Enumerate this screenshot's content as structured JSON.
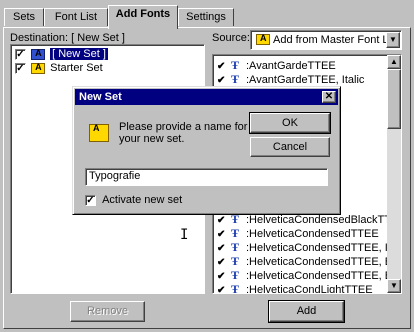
{
  "tabs": [
    {
      "label": "Sets",
      "active": false
    },
    {
      "label": "Font List",
      "active": false
    },
    {
      "label": "Add Fonts",
      "active": true
    },
    {
      "label": "Settings",
      "active": false
    }
  ],
  "destination": {
    "label": "Destination: [ New Set ]",
    "items": [
      {
        "label": "[ New Set ]",
        "checked": true,
        "selected": true,
        "icon": "blue-font-set-icon"
      },
      {
        "label": "Starter Set",
        "checked": true,
        "selected": false,
        "icon": "yellow-font-set-icon"
      }
    ]
  },
  "source": {
    "label": "Source:",
    "dropdown_value": "Add from Master Font List",
    "fonts": [
      {
        "name": "AvantGardeTTEE",
        "visible": "AvantGardeTTEE"
      },
      {
        "name": "AvantGardeTTEE, Italic",
        "visible": "AvantGardeTTEE, Italic"
      },
      {
        "name": "",
        "visible": ""
      },
      {
        "name": "d Italic",
        "visible": "d Italic"
      },
      {
        "name": "",
        "visible": ""
      },
      {
        "name": "",
        "visible": ""
      },
      {
        "name": "",
        "visible": ""
      },
      {
        "name": "",
        "visible": ""
      },
      {
        "name": "",
        "visible": ""
      },
      {
        "name": "talic",
        "visible": "talic"
      },
      {
        "name": "TEE",
        "visible": "TEE"
      },
      {
        "name": "HelveticaCondensedBlackTTEE, Italic",
        "visible": "HelveticaCondensedBlackTTEE, Italic"
      },
      {
        "name": "HelveticaCondensedTTEE",
        "visible": "HelveticaCondensedTTEE"
      },
      {
        "name": "HelveticaCondensedTTEE, Italic",
        "visible": "HelveticaCondensedTTEE, Italic"
      },
      {
        "name": "HelveticaCondensedTTEE, Bold",
        "visible": "HelveticaCondensedTTEE, Bold"
      },
      {
        "name": "HelveticaCondensedTTEE, Bold",
        "visible": "HelveticaCondensedTTEE, Bold"
      },
      {
        "name": "HelveticaCondLightTTEE",
        "visible": "HelveticaCondLightTTEE"
      }
    ]
  },
  "buttons": {
    "remove": "Remove",
    "add": "Add"
  },
  "dialog": {
    "title": "New Set",
    "prompt_line1": "Please provide a name for",
    "prompt_line2": "your new set.",
    "ok": "OK",
    "cancel": "Cancel",
    "name_value": "Typografie",
    "activate_label": "Activate new set",
    "activate_checked": true
  }
}
